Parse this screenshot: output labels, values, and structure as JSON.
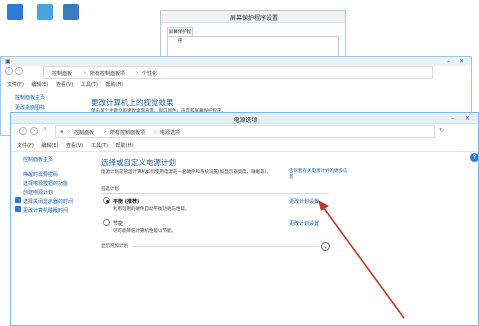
{
  "desktop": {
    "icons": [
      {
        "label": "",
        "color": "#2d7bd4"
      },
      {
        "label": "",
        "color": "#4aa3df"
      },
      {
        "label": "",
        "color": "#3b7cc0"
      }
    ]
  },
  "screensaver_window": {
    "title": "屏幕保护程序设置",
    "tab": "屏幕保护程序"
  },
  "personalize_window": {
    "breadcrumb": [
      "控制面板",
      "所有控制面板项",
      "个性化"
    ],
    "menu": [
      "文件(F)",
      "编辑(E)",
      "查看(V)",
      "工具(T)",
      "帮助(H)"
    ],
    "sidebar": [
      "控制面板主页",
      "更改桌面图标"
    ],
    "heading": "更改计算机上的视觉效果",
    "subtext": "单击某个主题立即更改桌面背景、窗口颜色、声音和屏幕保护程序。"
  },
  "power_window": {
    "title": "电源选项",
    "breadcrumb": [
      "控制面板",
      "所有控制面板项",
      "电源选项"
    ],
    "menu": [
      "文件(F)",
      "编辑(E)",
      "查看(V)",
      "工具(T)",
      "帮助(H)"
    ],
    "sidebar": {
      "home": "控制面板主页",
      "items": [
        "唤醒时需要密码",
        "选择电源按钮的功能",
        "创建电源计划",
        "选择关闭显示器的时间",
        "更改计算机睡眠时间"
      ]
    },
    "heading": "选择或自定义电源计划",
    "description": "电源计划是管理计算机如何使用电源的一套硬件和系统设置(如显示器亮度、睡眠等)。",
    "description_link": "告诉我有关电源计划的更多信息",
    "section_label": "首选计划",
    "plans": [
      {
        "name": "平衡 (推荐)",
        "desc": "利用可用的硬件自动平衡功耗与性能。",
        "link": "更改计划设置",
        "selected": true
      },
      {
        "name": "节能",
        "desc": "尽可能降低计算机性能以节能。",
        "link": "更改计划设置",
        "selected": false
      }
    ],
    "show_more": "显示附加计划",
    "help_glyph": "?"
  },
  "accent": "#1a5fa8",
  "arrow_color": "#c0392b"
}
